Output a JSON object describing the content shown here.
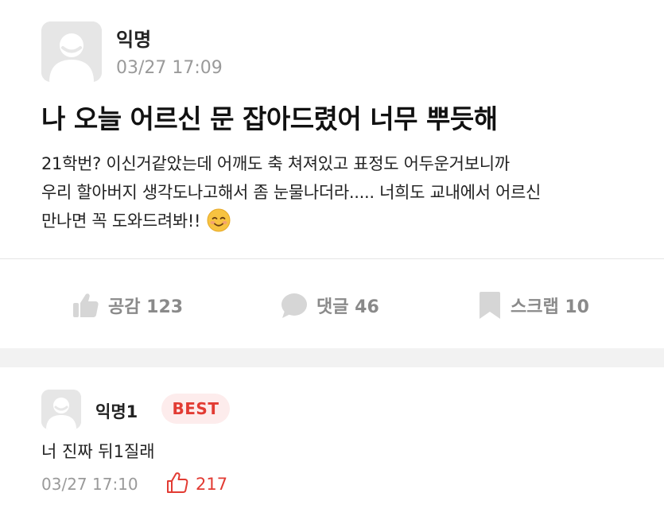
{
  "post": {
    "author": "익명",
    "time": "03/27 17:09",
    "title": "나 오늘 어르신 문 잡아드렸어 너무 뿌듯해",
    "body_lines": [
      "21학번? 이신거같았는데 어깨도 축 쳐져있고 표정도 어두운거보니까",
      "우리 할아버지 생각도나고해서 좀 눈물나더라..... 너희도 교내에서 어르신",
      "만나면 꼭 도와드려봐!!"
    ],
    "emoji": "smiling-face-icon"
  },
  "actions": {
    "like_label": "공감 123",
    "comment_label": "댓글 46",
    "scrap_label": "스크랩 10"
  },
  "comment": {
    "author": "익명1",
    "badge": "BEST",
    "text": "너 진짜 뒤1질래",
    "time": "03/27 17:10",
    "likes": "217"
  },
  "colors": {
    "accent_red": "#e23b33",
    "badge_bg": "#fdecec",
    "muted_gray": "#8a8a8a",
    "avatar_bg": "#e6e6e6"
  }
}
